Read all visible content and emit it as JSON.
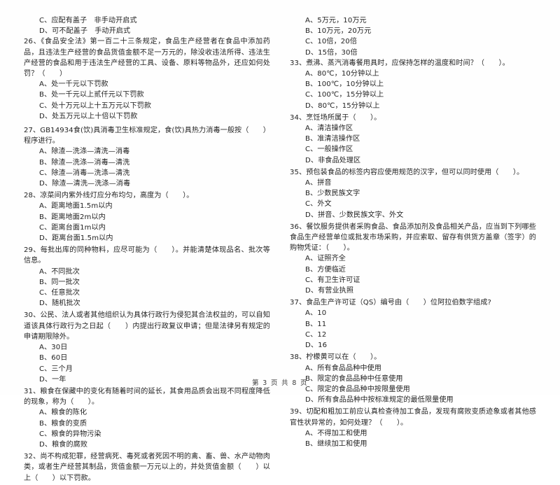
{
  "document": {
    "page_footer": "第 3 页 共 8 页",
    "page_number": "3",
    "total_pages": "8"
  },
  "left_column": {
    "orphan_options": [
      "C、应配有盖子　非手动开启式",
      "D、可不配盖子　手动开启式"
    ],
    "questions": [
      {
        "number": "26",
        "stem": "26、《食品安全法》第一百二十三条规定，食品生产经营者在食品中添加药品，且违法生产经营的食品货值金额不足一万元的，除没收违法所得、违法生产经营的食品和用于违法生产经营的工具、设备、原料等物品外，还应如何处罚？（　　）",
        "options": [
          "A、处一千元以下罚款",
          "B、处一千元以上贰仟元以下罚款",
          "C、处十万元以上十五万元以下罚款",
          "D、处五万元以上十倍以下罚款"
        ]
      },
      {
        "number": "27",
        "stem": "27、GB14934食(饮)具消毒卫生标准规定，食(饮)具热力消毒一般按（　　）程序进行。",
        "options": [
          "A、除渣—洗涤—清洗—消毒",
          "B、除渣—洗涤—消毒—清洗",
          "C、除渣—消毒—洗涤—清洗",
          "D、除渣—清洗—洗涤—消毒"
        ]
      },
      {
        "number": "28",
        "stem": "28、凉菜间内紫外线灯应分布均匀，高度为（　　）。",
        "options": [
          "A、距离地面1.5m以内",
          "B、距离地面2m以内",
          "C、距离台面1m以内",
          "D、距离台面1.5m以内"
        ]
      },
      {
        "number": "29",
        "stem": "29、每批出库的同种物料，应尽可能为（　　）。并能清楚体现品名、批次等信息。",
        "options": [
          "A、不同批次",
          "B、同一批次",
          "C、任意批次",
          "D、随机批次"
        ]
      },
      {
        "number": "30",
        "stem": "30、公民、法人或者其他组织认为具体行政行为侵犯其合法权益的，可以自知道该具体行政行为之日起（　　）内提出行政复议申请；但是法律另有规定的申请期限除外。",
        "options": [
          "A、30日",
          "B、60日",
          "C、三个月",
          "D、一年"
        ]
      },
      {
        "number": "31",
        "stem": "31、粮食在保藏中的变化有随着时间的延长，其食用品质会出现不同程度降低的现象，称为（　　）。",
        "options": [
          "A、粮食的陈化",
          "B、粮食的变质",
          "C、粮食的异物污染",
          "D、粮食的腐败"
        ]
      },
      {
        "number": "32",
        "stem": "32、尚不构成犯罪，经营病死、毒死或者死因不明的禽、畜、兽、水产动物肉类，或者生产经营其制品，货值金额一万元以上的，并处货值金额（　　）以上（　　）以下罚款。",
        "options": []
      }
    ]
  },
  "right_column": {
    "orphan_options": [
      "A、5万元，10万元",
      "B、10万元，20万元",
      "C、10倍，20倍",
      "D、15倍，30倍"
    ],
    "questions": [
      {
        "number": "33",
        "stem": "33、煮沸、蒸汽消毒餐用具时，应保持怎样的温度和时间？（　　）。",
        "options": [
          "A、80℃，10分钟以上",
          "B、100℃，10分钟以上",
          "C、100℃，15分钟以上",
          "D、80℃，15分钟以上"
        ]
      },
      {
        "number": "34",
        "stem": "34、烹饪场所属于（　　）。",
        "options": [
          "A、清洁操作区",
          "B、准清洁操作区",
          "C、一般操作区",
          "D、非食品处理区"
        ]
      },
      {
        "number": "35",
        "stem": "35、预包装食品的标签内容应使用规范的汉字，但可以同时使用（　　）。",
        "options": [
          "A、拼音",
          "B、少数民族文字",
          "C、外文",
          "D、拼音、少数民族文字、外文"
        ]
      },
      {
        "number": "36",
        "stem": "36、餐饮服务提供者采购食品、食品添加剂及食品相关产品，应当到下列哪些食品生产经营单位或批发市场采购，并应索取、留存有供货方盖章（签字）的购物凭证：（　　）。",
        "options": [
          "A、证照齐全",
          "B、方便临近",
          "C、有卫生许可证",
          "D、有营业执照"
        ]
      },
      {
        "number": "37",
        "stem": "37、食品生产许可证（QS）编号由（　　）位阿拉伯数字组成?",
        "options": [
          "A、10",
          "B、11",
          "C、12",
          "D、16"
        ]
      },
      {
        "number": "38",
        "stem": "38、柠檬黄可以在（　　）。",
        "options": [
          "A、所有食品品种中使用",
          "B、限定的食品品种中任意使用",
          "C、限定的食品品种中按限量使用",
          "D、所有食品品种中按标准规定的最低限量使用"
        ]
      },
      {
        "number": "39",
        "stem": "39、切配和粗加工前应认真检查待加工食品，发现有腐败变质迹象或者其他感官性状异常的，如何处理？（　　）。",
        "options": [
          "A、不得加工和使用",
          "B、继续加工和使用"
        ]
      }
    ]
  }
}
